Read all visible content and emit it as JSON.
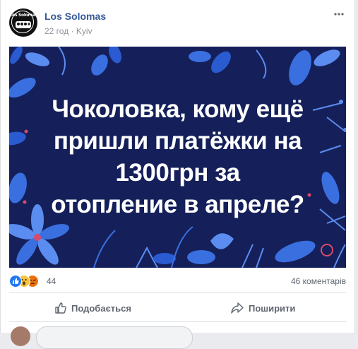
{
  "post": {
    "author": "Los Solomas",
    "timestamp": "22 год",
    "separator": "·",
    "location": "Kyiv",
    "avatar_text": "Los Solomas",
    "image": {
      "caption_lines": [
        "Чоколовка, кому ещё",
        "пришли платёжки на",
        "1300грн за",
        "отопление в апреле?"
      ],
      "background_color": "#15205a",
      "accent_colors": [
        "#3a6fe0",
        "#5b8df0",
        "#d94a6a"
      ]
    },
    "reactions": {
      "icons": [
        "like-icon",
        "wow-icon",
        "angry-icon"
      ],
      "count": "44"
    },
    "comments_count": "46 коментарів",
    "actions": {
      "like_label": "Подобається",
      "share_label": "Поширити"
    }
  },
  "colors": {
    "author_link": "#365899",
    "meta_text": "#90949c",
    "action_text": "#606770",
    "like_blue": "#2078f4"
  }
}
